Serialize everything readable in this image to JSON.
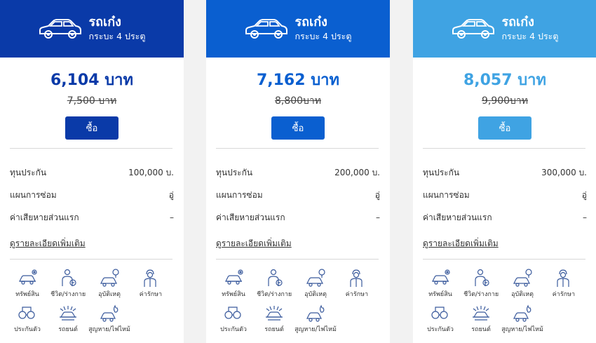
{
  "cards": [
    {
      "title": "รถเก๋ง",
      "subtitle": "กระบะ 4 ประตู",
      "price": "6,104 บาท",
      "old_price": "7,500 บาท",
      "buy_label": "ซื้อ",
      "rows": [
        {
          "label": "ทุนประกัน",
          "value": "100,000 บ."
        },
        {
          "label": "แผนการซ่อม",
          "value": "อู่"
        },
        {
          "label": "ค่าเสียหายส่วนแรก",
          "value": "–"
        }
      ],
      "more_label": "ดูรายละเอียดเพิ่มเติม",
      "coverage": [
        {
          "icon": "car-damage-icon",
          "label": "ทรัพย์สิน"
        },
        {
          "icon": "person-injury-icon",
          "label": "ชีวิต/ร่างกาย"
        },
        {
          "icon": "car-accident-icon",
          "label": "อุบัติเหตุ"
        },
        {
          "icon": "doctor-icon",
          "label": "ค่ารักษา"
        },
        {
          "icon": "bail-bond-icon",
          "label": "ประกันตัว"
        },
        {
          "icon": "car-crash-icon",
          "label": "รถยนต์"
        },
        {
          "icon": "car-fire-theft-icon",
          "label": "สูญหาย/ไฟไหม้"
        }
      ]
    },
    {
      "title": "รถเก๋ง",
      "subtitle": "กระบะ 4 ประตู",
      "price": "7,162 บาท",
      "old_price": "8,800บาท",
      "buy_label": "ซื้อ",
      "rows": [
        {
          "label": "ทุนประกัน",
          "value": "200,000 บ."
        },
        {
          "label": "แผนการซ่อม",
          "value": "อู่"
        },
        {
          "label": "ค่าเสียหายส่วนแรก",
          "value": "–"
        }
      ],
      "more_label": "ดูรายละเอียดเพิ่มเติม",
      "coverage": [
        {
          "icon": "car-damage-icon",
          "label": "ทรัพย์สิน"
        },
        {
          "icon": "person-injury-icon",
          "label": "ชีวิต/ร่างกาย"
        },
        {
          "icon": "car-accident-icon",
          "label": "อุบัติเหตุ"
        },
        {
          "icon": "doctor-icon",
          "label": "ค่ารักษา"
        },
        {
          "icon": "bail-bond-icon",
          "label": "ประกันตัว"
        },
        {
          "icon": "car-crash-icon",
          "label": "รถยนต์"
        },
        {
          "icon": "car-fire-theft-icon",
          "label": "สูญหาย/ไฟไหม้"
        }
      ]
    },
    {
      "title": "รถเก๋ง",
      "subtitle": "กระบะ 4 ประตู",
      "price": "8,057 บาท",
      "old_price": "9,900บาท",
      "buy_label": "ซื้อ",
      "rows": [
        {
          "label": "ทุนประกัน",
          "value": "300,000 บ."
        },
        {
          "label": "แผนการซ่อม",
          "value": "อู่"
        },
        {
          "label": "ค่าเสียหายส่วนแรก",
          "value": "–"
        }
      ],
      "more_label": "ดูรายละเอียดเพิ่มเติม",
      "coverage": [
        {
          "icon": "car-damage-icon",
          "label": "ทรัพย์สิน"
        },
        {
          "icon": "person-injury-icon",
          "label": "ชีวิต/ร่างกาย"
        },
        {
          "icon": "car-accident-icon",
          "label": "อุบัติเหตุ"
        },
        {
          "icon": "doctor-icon",
          "label": "ค่ารักษา"
        },
        {
          "icon": "bail-bond-icon",
          "label": "ประกันตัว"
        },
        {
          "icon": "car-crash-icon",
          "label": "รถยนต์"
        },
        {
          "icon": "car-fire-theft-icon",
          "label": "สูญหาย/ไฟไหม้"
        }
      ]
    }
  ],
  "colors": {
    "card1_header": "#0a3aa8",
    "card2_header": "#0a5fd0",
    "card3_header": "#3fa3e3",
    "card1_price": "#0a3aa8",
    "card2_price": "#0a5fd0",
    "card3_price": "#3fa3e3",
    "card1_button": "#0a3aa8",
    "card2_button": "#0a5fd0",
    "card3_button": "#3fa3e3",
    "icon_stroke": "#3a5a9c"
  }
}
